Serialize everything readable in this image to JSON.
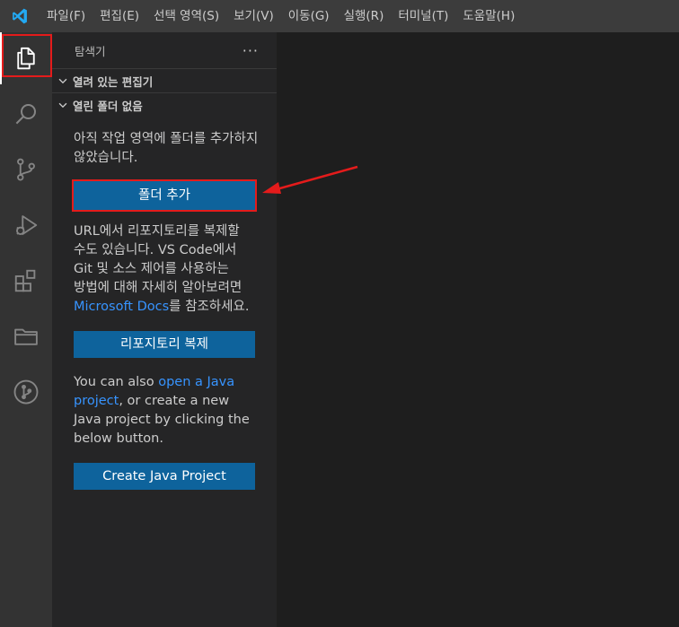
{
  "menu": {
    "items": [
      "파일(F)",
      "편집(E)",
      "선택 영역(S)",
      "보기(V)",
      "이동(G)",
      "실행(R)",
      "터미널(T)",
      "도움말(H)"
    ]
  },
  "activity": {
    "items": [
      "files-icon",
      "search-icon",
      "source-control-icon",
      "run-debug-icon",
      "extensions-icon",
      "folder-icon",
      "git-graph-icon"
    ]
  },
  "sidebar": {
    "title": "탐색기",
    "more": "···",
    "sections": {
      "open_editors": "열려 있는 편집기",
      "no_folder": "열린 폴더 없음"
    },
    "no_folder_text": "아직 작업 영역에 폴더를 추가하지 않았습니다.",
    "add_folder_button": "폴더 추가",
    "clone_text_1": "URL에서 리포지토리를 복제할 수도 있습니다. VS Code에서 Git 및 소스 제어를 사용하는 방법에 대해 자세히 알아보려면 ",
    "clone_link": "Microsoft Docs",
    "clone_text_2": "를 참조하세요.",
    "clone_button": "리포지토리 복제",
    "java_text_1": "You can also ",
    "java_link": "open a Java project",
    "java_text_2": ", or create a new Java project by clicking the below button.",
    "java_button": "Create Java Project"
  },
  "colors": {
    "accent_button": "#0e639c",
    "link": "#3794ff",
    "highlight": "#e41b1b"
  }
}
